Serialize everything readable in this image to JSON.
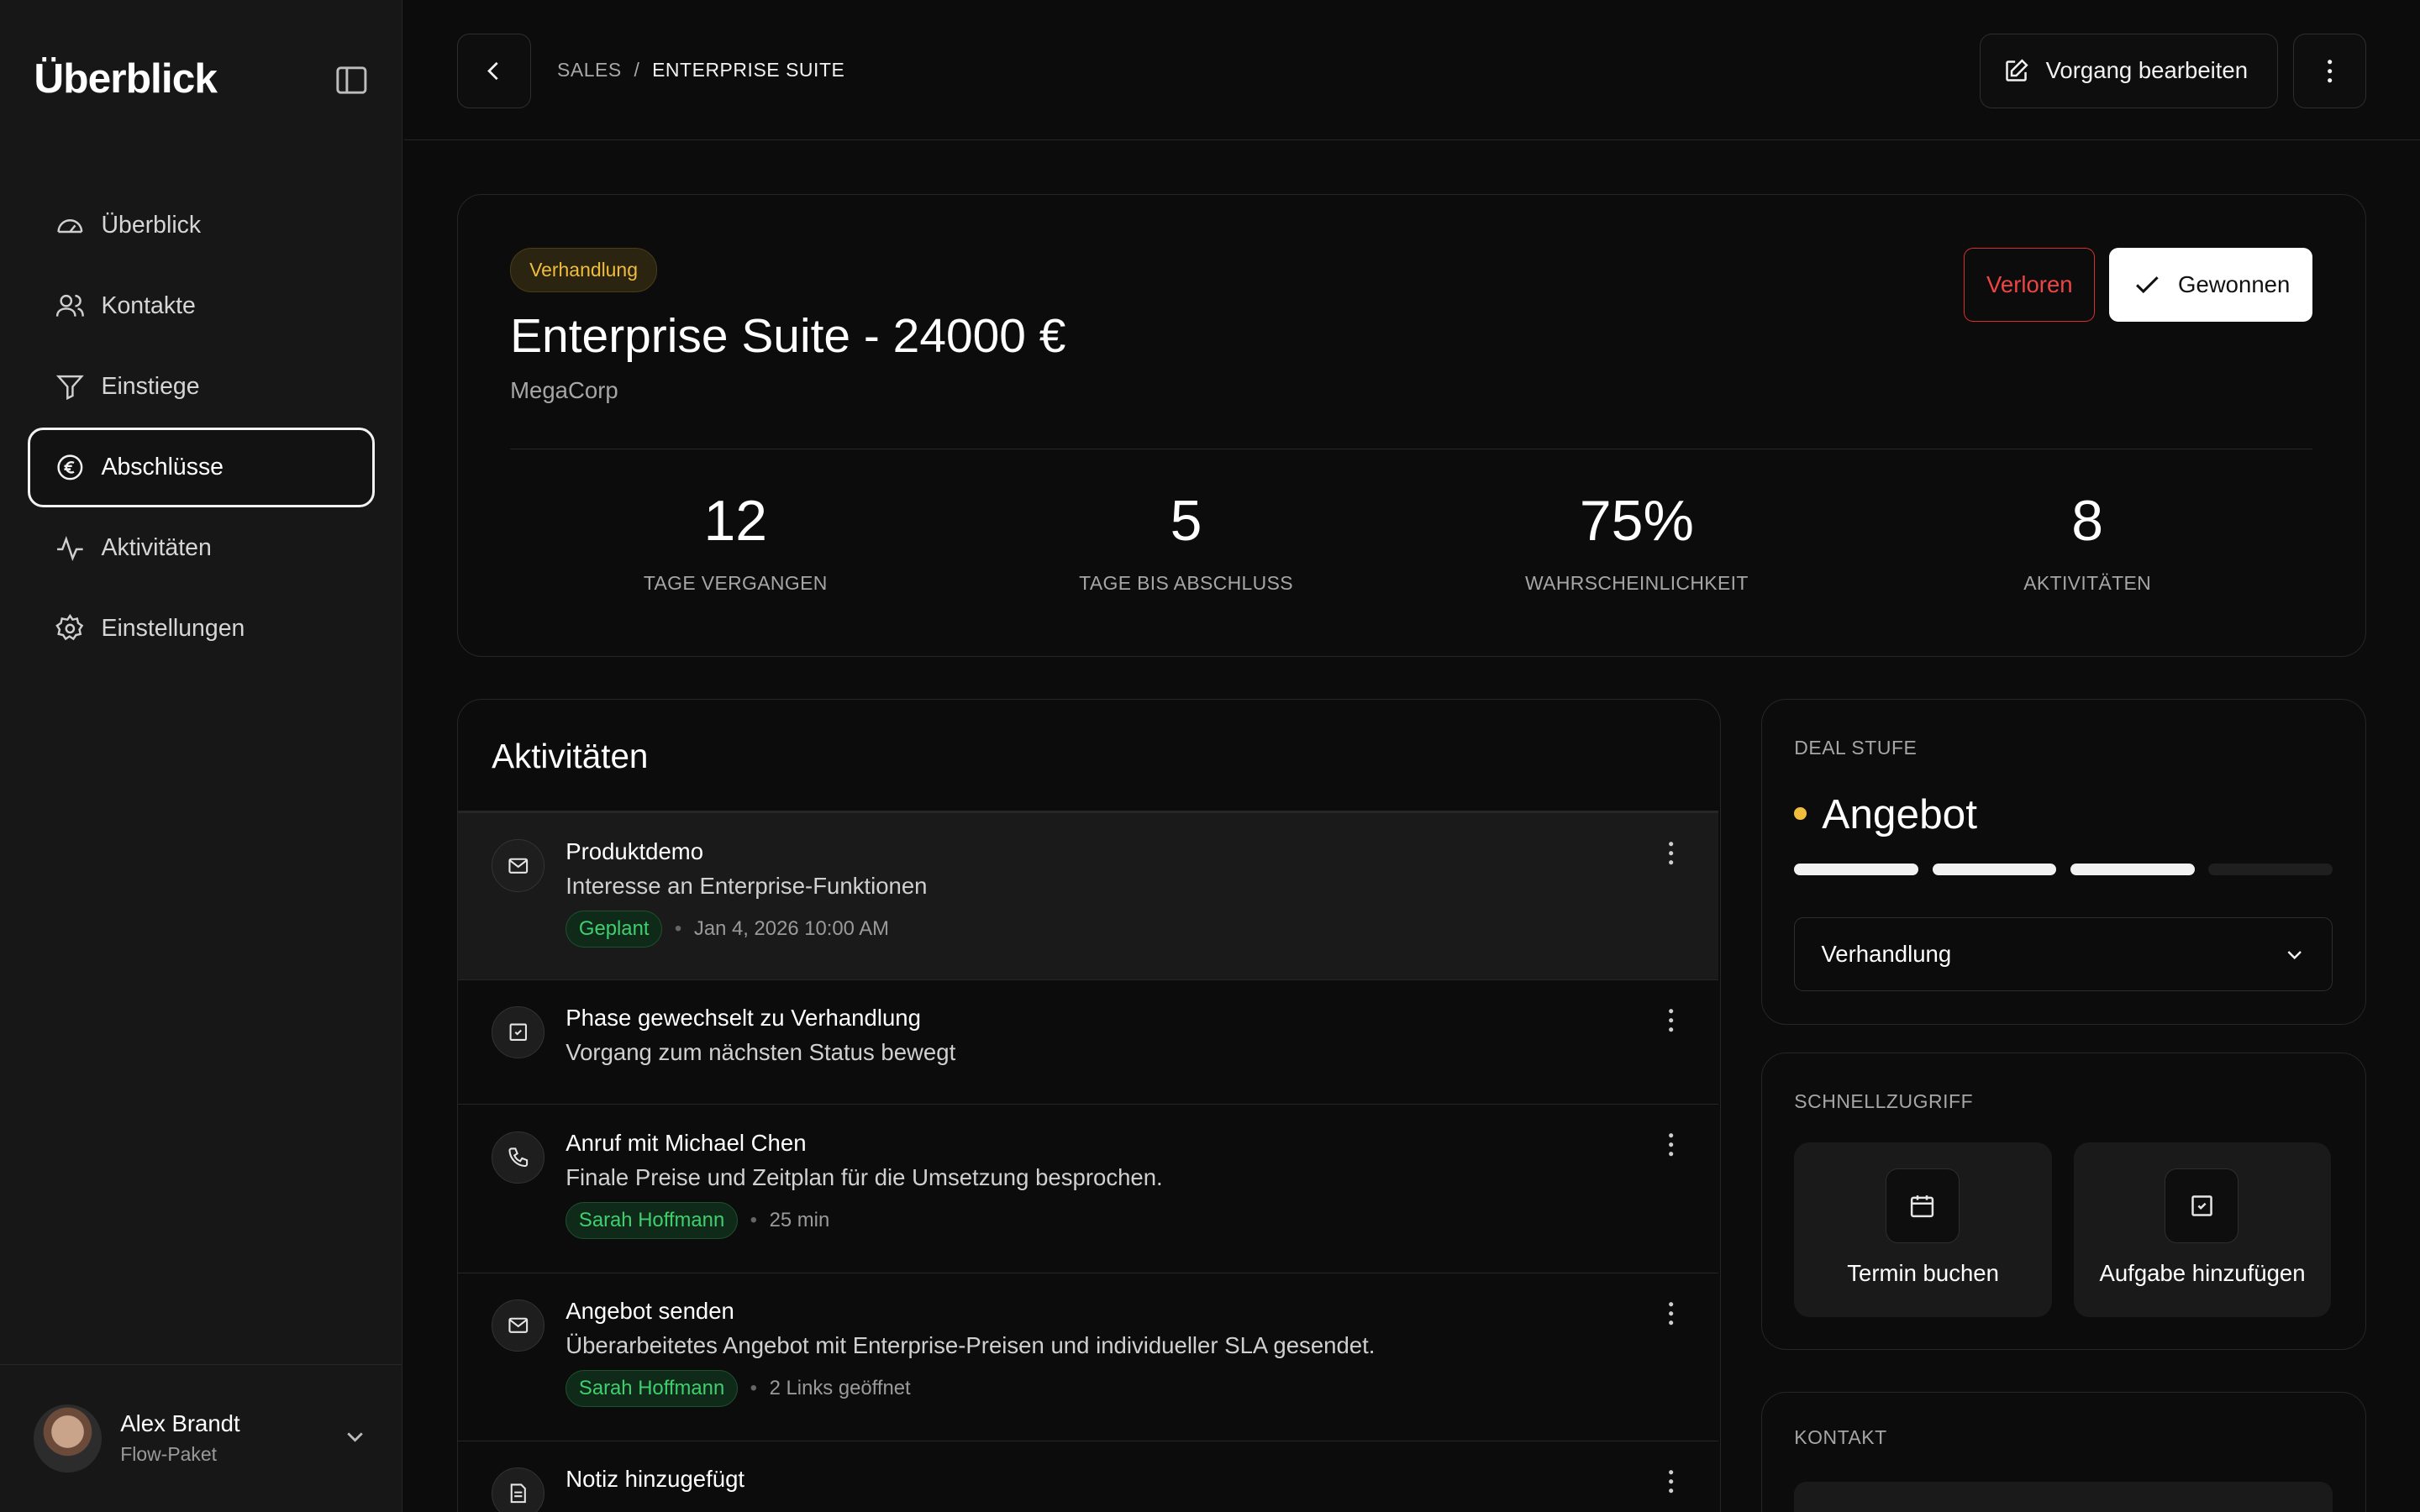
{
  "sidebar": {
    "brand": "Überblick",
    "items": [
      {
        "label": "Überblick"
      },
      {
        "label": "Kontakte"
      },
      {
        "label": "Einstiege"
      },
      {
        "label": "Abschlüsse"
      },
      {
        "label": "Aktivitäten"
      },
      {
        "label": "Einstellungen"
      }
    ],
    "user": {
      "name": "Alex Brandt",
      "plan": "Flow-Paket"
    }
  },
  "topbar": {
    "breadcrumb": [
      "SALES",
      "/",
      "ENTERPRISE SUITE"
    ],
    "edit_label": "Vorgang bearbeiten"
  },
  "deal": {
    "stage_badge": "Verhandlung",
    "title": "Enterprise Suite - 24000 €",
    "company": "MegaCorp",
    "lost_label": "Verloren",
    "won_label": "Gewonnen",
    "stats": [
      {
        "value": "12",
        "label": "TAGE VERGANGEN"
      },
      {
        "value": "5",
        "label": "TAGE BIS ABSCHLUSS"
      },
      {
        "value": "75%",
        "label": "WAHRSCHEINLICHKEIT"
      },
      {
        "value": "8",
        "label": "AKTIVITÄTEN"
      }
    ]
  },
  "activities": {
    "title": "Aktivitäten",
    "items": [
      {
        "icon": "mail-icon",
        "name": "Produktdemo",
        "desc": "Interesse an Enterprise-Funktionen",
        "tag": "Geplant",
        "meta": "Jan 4, 2026 10:00 AM"
      },
      {
        "icon": "task-icon",
        "name": "Phase gewechselt zu Verhandlung",
        "desc": "Vorgang zum nächsten Status bewegt"
      },
      {
        "icon": "phone-icon",
        "name": "Anruf mit Michael Chen",
        "desc": "Finale Preise und Zeitplan für die Umsetzung besprochen.",
        "tag": "Sarah Hoffmann",
        "meta": "25 min"
      },
      {
        "icon": "mail-icon",
        "name": "Angebot senden",
        "desc": "Überarbeitetes Angebot mit Enterprise-Preisen und individueller SLA gesendet.",
        "tag": "Sarah Hoffmann",
        "meta": "2 Links geöffnet"
      },
      {
        "icon": "note-icon",
        "name": "Notiz hinzugefügt",
        "desc": ""
      }
    ]
  },
  "stage_panel": {
    "label": "DEAL STUFE",
    "current": "Angebot",
    "progress_filled": 3,
    "progress_total": 4,
    "accent": "#f0bd3c",
    "select_value": "Verhandlung"
  },
  "quick_access": {
    "label": "SCHNELLZUGRIFF",
    "actions": [
      {
        "label": "Termin buchen",
        "icon": "calendar-icon"
      },
      {
        "label": "Aufgabe hinzufügen",
        "icon": "task-icon"
      }
    ]
  },
  "contact": {
    "label": "KONTAKT"
  },
  "colors": {
    "lost": "#ef4444",
    "tag_green": "#3fcf6e",
    "badge_amber": "#f0bd3c"
  }
}
